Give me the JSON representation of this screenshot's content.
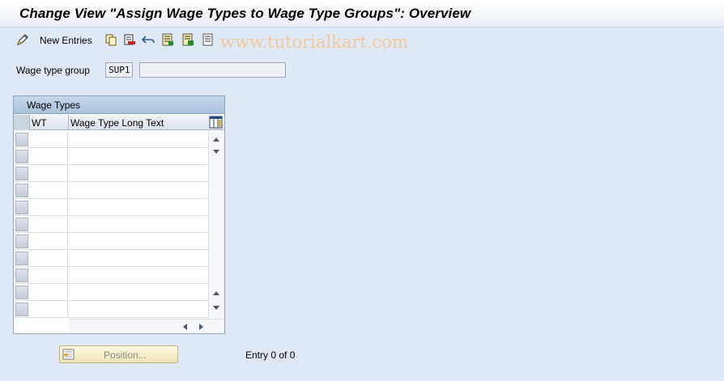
{
  "title": "Change View \"Assign Wage Types to Wage Type Groups\": Overview",
  "toolbar": {
    "new_entries_label": "New Entries",
    "icons": [
      "edit-pencil-icon",
      "copy-icon",
      "delete-icon",
      "undo-icon",
      "select-all-icon",
      "select-block-icon",
      "deselect-all-icon"
    ]
  },
  "watermark": "www.tutorialkart.com",
  "selection": {
    "label": "Wage type group",
    "key_value": "SUP1",
    "description_value": ""
  },
  "table": {
    "title": "Wage Types",
    "columns": [
      "WT",
      "Wage Type Long Text"
    ],
    "rows": [
      [
        "",
        ""
      ],
      [
        "",
        ""
      ],
      [
        "",
        ""
      ],
      [
        "",
        ""
      ],
      [
        "",
        ""
      ],
      [
        "",
        ""
      ],
      [
        "",
        ""
      ],
      [
        "",
        ""
      ],
      [
        "",
        ""
      ],
      [
        "",
        ""
      ],
      [
        "",
        ""
      ]
    ]
  },
  "footer": {
    "position_button": "Position...",
    "entry_text": "Entry 0 of 0"
  },
  "colors": {
    "background": "#dfe9f5",
    "table_header": "#a9c1dc",
    "position_button": "#efe3b4",
    "watermark": "#f3c79a"
  }
}
